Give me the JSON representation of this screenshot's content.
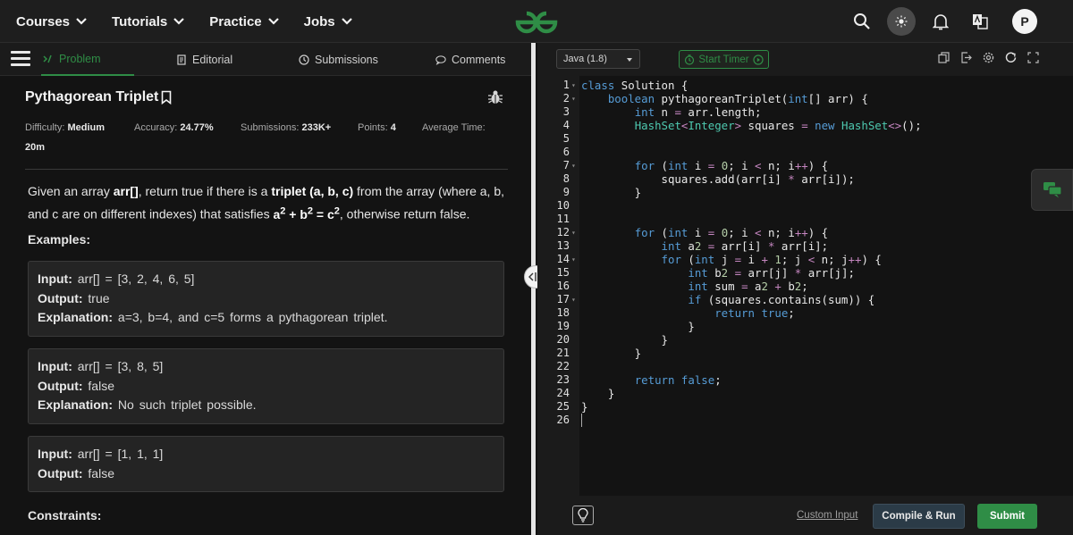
{
  "nav": {
    "items": [
      {
        "label": "Courses"
      },
      {
        "label": "Tutorials"
      },
      {
        "label": "Practice"
      },
      {
        "label": "Jobs"
      }
    ],
    "avatar_initial": "P"
  },
  "tabs": [
    {
      "label": "Problem",
      "active": true
    },
    {
      "label": "Editorial"
    },
    {
      "label": "Submissions"
    },
    {
      "label": "Comments"
    }
  ],
  "problem": {
    "title": "Pythagorean Triplet",
    "difficulty_label": "Difficulty:",
    "difficulty": "Medium",
    "accuracy_label": "Accuracy:",
    "accuracy": "24.77%",
    "submissions_label": "Submissions:",
    "submissions": "233K+",
    "points_label": "Points:",
    "points": "4",
    "avg_time_label": "Average Time:",
    "avg_time": "20m",
    "description": {
      "p1": "Given an array ",
      "arr": "arr[]",
      "p2": ", return true if there is a ",
      "triplet": "triplet (a, b, c)",
      "p3": " from the array (where a, b, and c are on different indexes) that satisfies ",
      "p4": ", otherwise return false."
    },
    "examples_heading": "Examples:",
    "examples": [
      {
        "input": "arr[] = [3, 2, 4, 6, 5]",
        "output": "true",
        "explanation": "a=3, b=4, and c=5 forms a pythagorean triplet."
      },
      {
        "input": "arr[] = [3, 8, 5]",
        "output": "false",
        "explanation": "No such triplet possible."
      },
      {
        "input": "arr[] = [1, 1, 1]",
        "output": "false"
      }
    ],
    "labels": {
      "input": "Input:",
      "output": "Output:",
      "explanation": "Explanation:"
    },
    "constraints_heading": "Constraints:"
  },
  "editor": {
    "language": "Java (1.8)",
    "timer_label": "Start Timer",
    "code_lines": [
      "class Solution {",
      "    boolean pythagoreanTriplet(int[] arr) {",
      "        int n = arr.length;",
      "        HashSet<Integer> squares = new HashSet<>();",
      "",
      "",
      "        for (int i = 0; i < n; i++) {",
      "            squares.add(arr[i] * arr[i]);",
      "        }",
      "",
      "",
      "        for (int i = 0; i < n; i++) {",
      "            int a2 = arr[i] * arr[i];",
      "            for (int j = i + 1; j < n; j++) {",
      "                int b2 = arr[j] * arr[j];",
      "                int sum = a2 + b2;",
      "                if (squares.contains(sum)) {",
      "                    return true;",
      "                }",
      "            }",
      "        }",
      "",
      "        return false;",
      "    }",
      "}",
      ""
    ],
    "fold_lines": [
      1,
      2,
      7,
      12,
      14,
      17
    ],
    "custom_input_label": "Custom Input",
    "compile_label": "Compile & Run",
    "submit_label": "Submit"
  },
  "colors": {
    "accent": "#2f8d46",
    "background": "#131313",
    "panel": "#1b1b1b"
  }
}
